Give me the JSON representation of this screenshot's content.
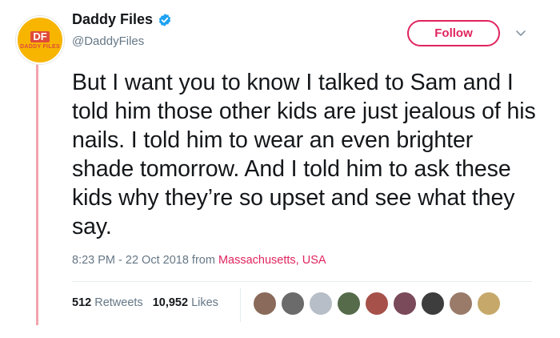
{
  "account": {
    "display_name": "Daddy Files",
    "handle": "@DaddyFiles",
    "verified": true,
    "avatar": {
      "monogram": "DF",
      "caption": "DADDY FILES"
    }
  },
  "actions": {
    "follow_label": "Follow",
    "menu_icon": "chevron-down-icon"
  },
  "tweet": {
    "text": "But I want you to know I talked to Sam and I told him those other kids are just jealous of his nails. I told him to wear an even brighter shade tomorrow. And I told him to ask these kids why they’re so upset and see what they say.",
    "time": "8:23 PM - 22 Oct 2018",
    "from_label": "from",
    "location": "Massachusetts, USA"
  },
  "stats": {
    "retweets_count": "512",
    "retweets_label": "Retweets",
    "likes_count": "10,952",
    "likes_label": "Likes"
  },
  "likers": [
    {
      "name": "liker-1",
      "color": "#8a6a5a"
    },
    {
      "name": "liker-2",
      "color": "#6b6b6b"
    },
    {
      "name": "liker-3",
      "color": "#b7bec7"
    },
    {
      "name": "liker-4",
      "color": "#556b4a"
    },
    {
      "name": "liker-5",
      "color": "#a6514a"
    },
    {
      "name": "liker-6",
      "color": "#7a4a5a"
    },
    {
      "name": "liker-7",
      "color": "#3d3d3d"
    },
    {
      "name": "liker-8",
      "color": "#9a7b6a"
    },
    {
      "name": "liker-9",
      "color": "#c6a96a"
    }
  ],
  "colors": {
    "accent": "#e0245e",
    "verified": "#1da1f2",
    "thread_line": "#f3a3ad",
    "muted": "#657786"
  }
}
